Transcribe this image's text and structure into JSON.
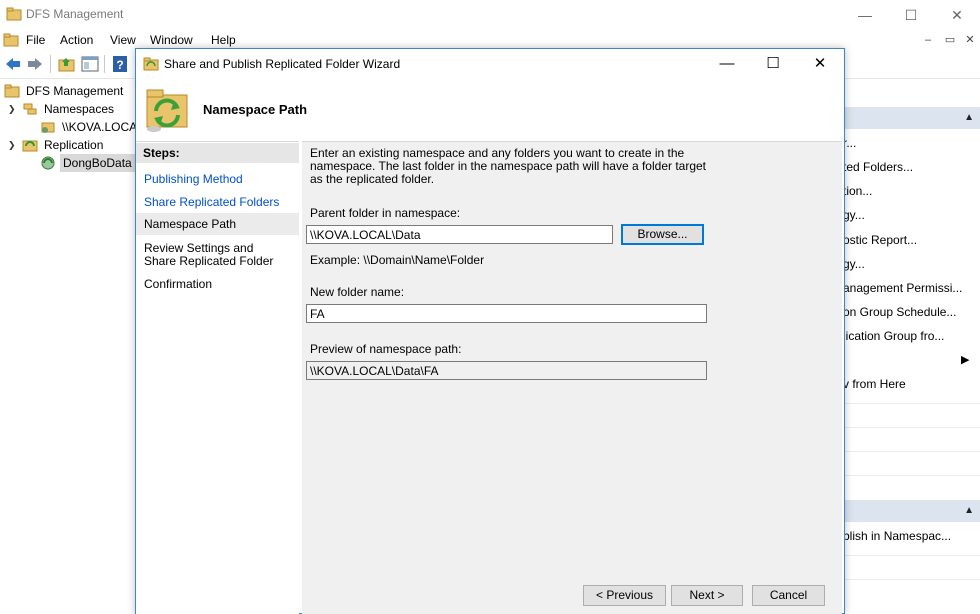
{
  "main_window": {
    "title": "DFS Management",
    "controls": {
      "minimize": "—",
      "maximize": "☐",
      "close": "✕"
    },
    "menu": [
      "File",
      "Action",
      "View",
      "Window",
      "Help"
    ],
    "mdi_controls": {
      "minimize": "–",
      "restore": "▭",
      "close": "✕"
    }
  },
  "tree": {
    "root": "DFS Management",
    "namespaces": "Namespaces",
    "namespace_item": "\\\\KOVA.LOCAL",
    "replication": "Replication",
    "replication_item": "DongBoData"
  },
  "actions": {
    "items_group1": [
      "r...",
      "ted Folders...",
      "tion...",
      "gy...",
      "ostic Report...",
      "gy...",
      "anagement Permissi...",
      "on Group Schedule...",
      "lication Group fro...",
      "",
      "v from Here"
    ],
    "items_group2": [
      "blish in Namespac..."
    ]
  },
  "wizard": {
    "title": "Share and Publish Replicated Folder Wizard",
    "page_title": "Namespace Path",
    "steps_label": "Steps:",
    "steps": [
      {
        "label": "Publishing Method",
        "state": "link"
      },
      {
        "label": "Share Replicated Folders",
        "state": "link"
      },
      {
        "label": "Namespace Path",
        "state": "current"
      },
      {
        "label": "Review Settings and Share Replicated Folder",
        "state": "plain"
      },
      {
        "label": "Confirmation",
        "state": "plain"
      }
    ],
    "intro": "Enter an existing namespace and any folders you want to create in the namespace. The last folder in the namespace path will have a folder target as the replicated folder.",
    "parent_label": "Parent folder in namespace:",
    "parent_value": "\\\\KOVA.LOCAL\\Data",
    "browse_label": "Browse...",
    "example": "Example: \\\\Domain\\Name\\Folder",
    "new_folder_label": "New folder name:",
    "new_folder_value": "FA",
    "preview_label": "Preview of namespace path:",
    "preview_value": "\\\\KOVA.LOCAL\\Data\\FA",
    "previous_label": "< Previous",
    "next_label": "Next >",
    "cancel_label": "Cancel",
    "controls": {
      "minimize": "—",
      "maximize": "☐",
      "close": "✕"
    }
  }
}
